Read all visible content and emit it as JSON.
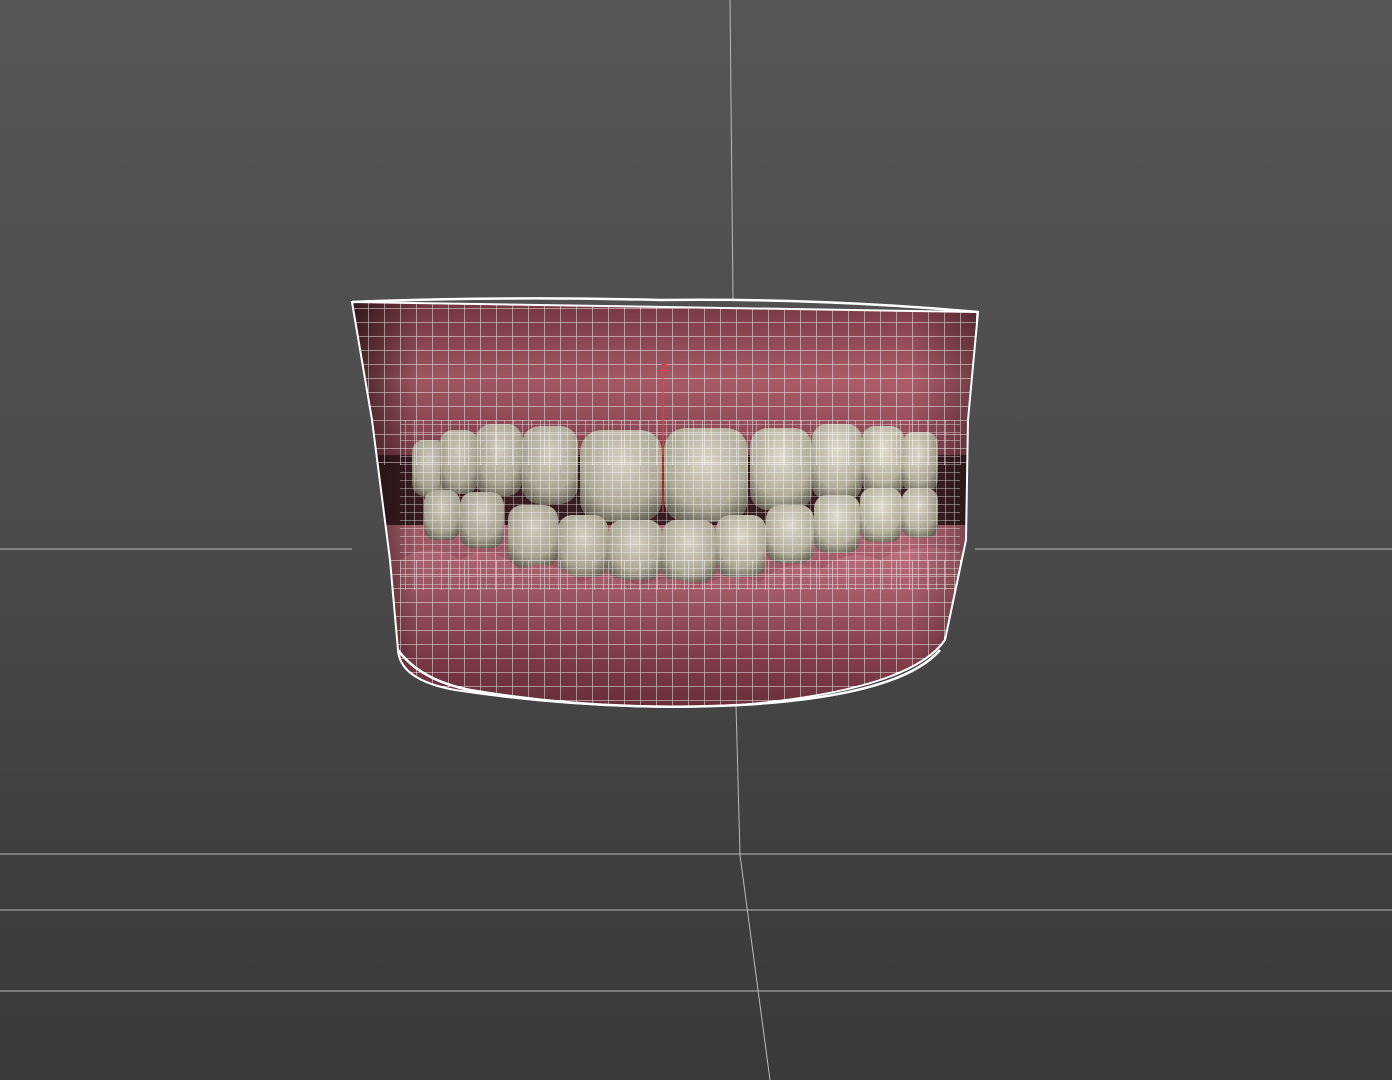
{
  "viewport": {
    "background_color": "#4e4e4e",
    "grid_color": "#b9b9b9",
    "wire_color": "#ffffff",
    "gum_color": "#9a4a58",
    "tooth_color": "#d9d6c2",
    "pivot_axis_label": "Z",
    "pivot_axis_color": "#ff3b3b"
  },
  "model": {
    "icon": "teeth-wireframe-model",
    "shading": "wireframe-on-shaded"
  }
}
